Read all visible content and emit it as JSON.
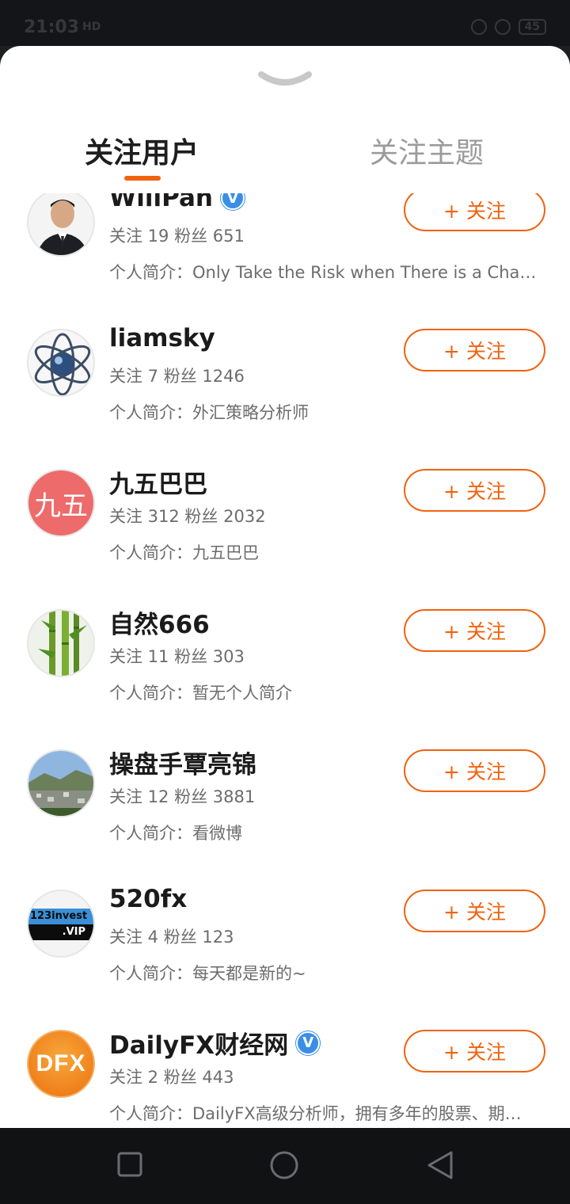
{
  "status_bar": {
    "time": "21:03",
    "network": "HD",
    "battery": "45"
  },
  "tabs": [
    {
      "label": "关注用户",
      "active": true
    },
    {
      "label": "关注主题",
      "active": false
    }
  ],
  "follow_label": "+ 关注",
  "bio_prefix": "个人简介：",
  "users": [
    {
      "name": "WillPan",
      "verified": true,
      "stats": "关注 19 粉丝 651",
      "bio": "个人简介：Only Take the Risk when There is a Chan…",
      "avatar": "portrait-photo"
    },
    {
      "name": "liamsky",
      "verified": false,
      "stats": "关注 7 粉丝 1246",
      "bio": "个人简介：外汇策略分析师",
      "avatar": "atom-logo"
    },
    {
      "name": "九五巴巴",
      "verified": false,
      "stats": "关注 312 粉丝 2032",
      "bio": "个人简介：九五巴巴",
      "avatar_text": "九五",
      "avatar_color": "#ee6b6b"
    },
    {
      "name": "自然666",
      "verified": false,
      "stats": "关注 11 粉丝 303",
      "bio": "个人简介：暂无个人简介",
      "avatar": "bamboo-image"
    },
    {
      "name": "操盘手覃亮锦",
      "verified": false,
      "stats": "关注 12 粉丝 3881",
      "bio": "个人简介：看微博",
      "avatar": "landscape-photo"
    },
    {
      "name": "520fx",
      "verified": false,
      "stats": "关注 4 粉丝 123",
      "bio": "个人简介：每天都是新的~",
      "avatar_text_top": "123invest",
      "avatar_text_bottom": ".VIP"
    },
    {
      "name": "DailyFX财经网",
      "verified": true,
      "stats": "关注 2 粉丝 443",
      "bio": "个人简介：DailyFX高级分析师，拥有多年的股票、期…",
      "avatar_text": "DFX",
      "avatar_color": "#f08a1a"
    }
  ],
  "colors": {
    "accent": "#f0620e",
    "verified": "#3b8ee6"
  }
}
